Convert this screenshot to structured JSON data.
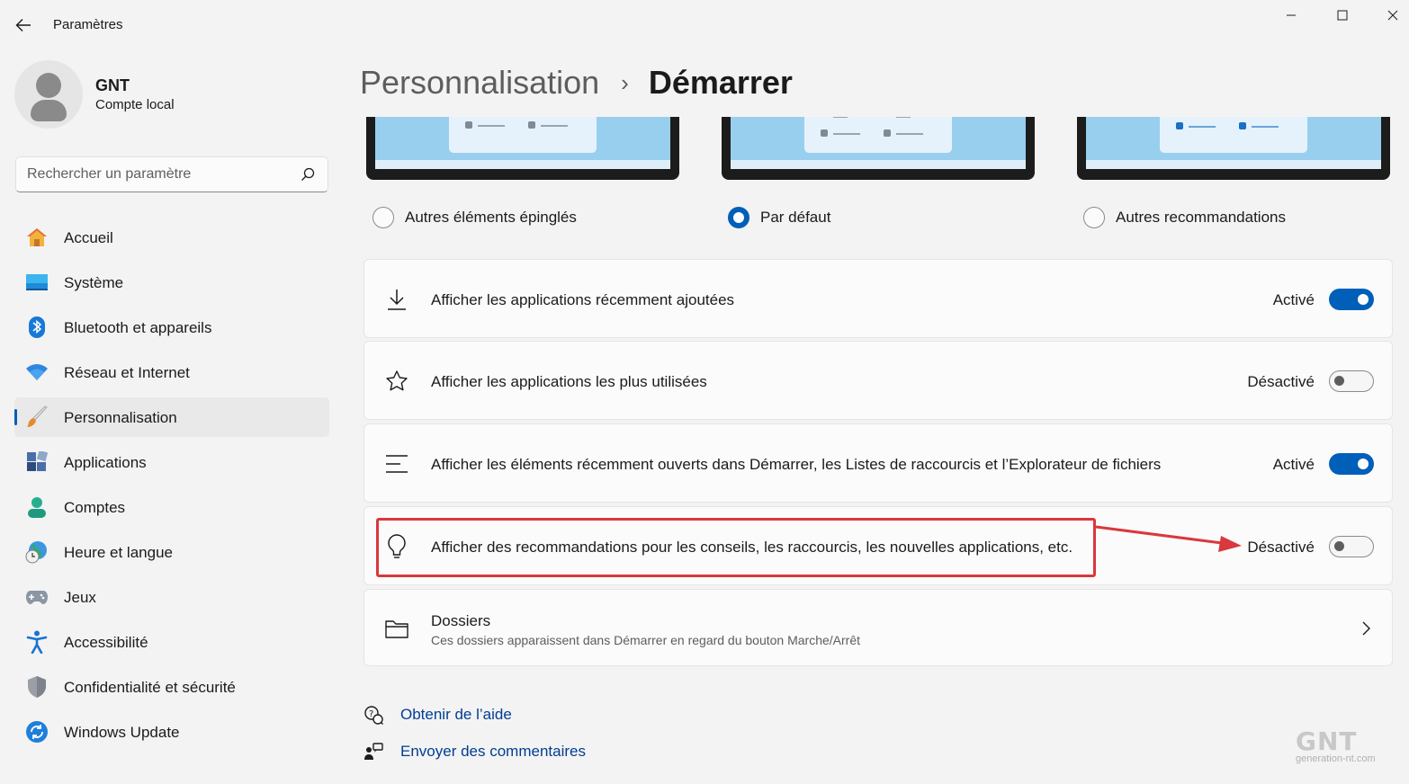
{
  "app": {
    "title": "Paramètres"
  },
  "account": {
    "name": "GNT",
    "type": "Compte local"
  },
  "search": {
    "placeholder": "Rechercher un paramètre"
  },
  "sidebar": {
    "items": [
      {
        "label": "Accueil",
        "icon": "home-icon"
      },
      {
        "label": "Système",
        "icon": "display-icon"
      },
      {
        "label": "Bluetooth et appareils",
        "icon": "bluetooth-icon"
      },
      {
        "label": "Réseau et Internet",
        "icon": "wifi-icon"
      },
      {
        "label": "Personnalisation",
        "icon": "brush-icon",
        "active": true
      },
      {
        "label": "Applications",
        "icon": "apps-icon"
      },
      {
        "label": "Comptes",
        "icon": "person-icon"
      },
      {
        "label": "Heure et langue",
        "icon": "globe-clock-icon"
      },
      {
        "label": "Jeux",
        "icon": "gamepad-icon"
      },
      {
        "label": "Accessibilité",
        "icon": "accessibility-icon"
      },
      {
        "label": "Confidentialité et sécurité",
        "icon": "shield-icon"
      },
      {
        "label": "Windows Update",
        "icon": "update-icon"
      }
    ]
  },
  "breadcrumb": {
    "parent": "Personnalisation",
    "separator": "›",
    "current": "Démarrer"
  },
  "layout_options": [
    {
      "label": "Autres éléments épinglés",
      "selected": false
    },
    {
      "label": "Par défaut",
      "selected": true
    },
    {
      "label": "Autres recommandations",
      "selected": false
    }
  ],
  "settings": [
    {
      "label": "Afficher les applications récemment ajoutées",
      "state": "Activé",
      "on": true,
      "icon": "download-icon"
    },
    {
      "label": "Afficher les applications les plus utilisées",
      "state": "Désactivé",
      "on": false,
      "icon": "star-icon"
    },
    {
      "label": "Afficher les éléments récemment ouverts dans Démarrer, les Listes de raccourcis et l’Explorateur de fichiers",
      "state": "Activé",
      "on": true,
      "icon": "list-icon"
    },
    {
      "label": "Afficher des recommandations pour les conseils, les raccourcis, les nouvelles applications, etc.",
      "state": "Désactivé",
      "on": false,
      "icon": "lightbulb-icon"
    }
  ],
  "folders": {
    "label": "Dossiers",
    "description": "Ces dossiers apparaissent dans Démarrer en regard du bouton Marche/Arrêt",
    "icon": "folder-icon"
  },
  "footer": {
    "help": "Obtenir de l’aide",
    "feedback": "Envoyer des commentaires"
  },
  "watermark": {
    "logo": "GNT",
    "site": "generation-nt.com"
  },
  "colors": {
    "accent": "#005fb8",
    "annotation": "#d9383e"
  }
}
